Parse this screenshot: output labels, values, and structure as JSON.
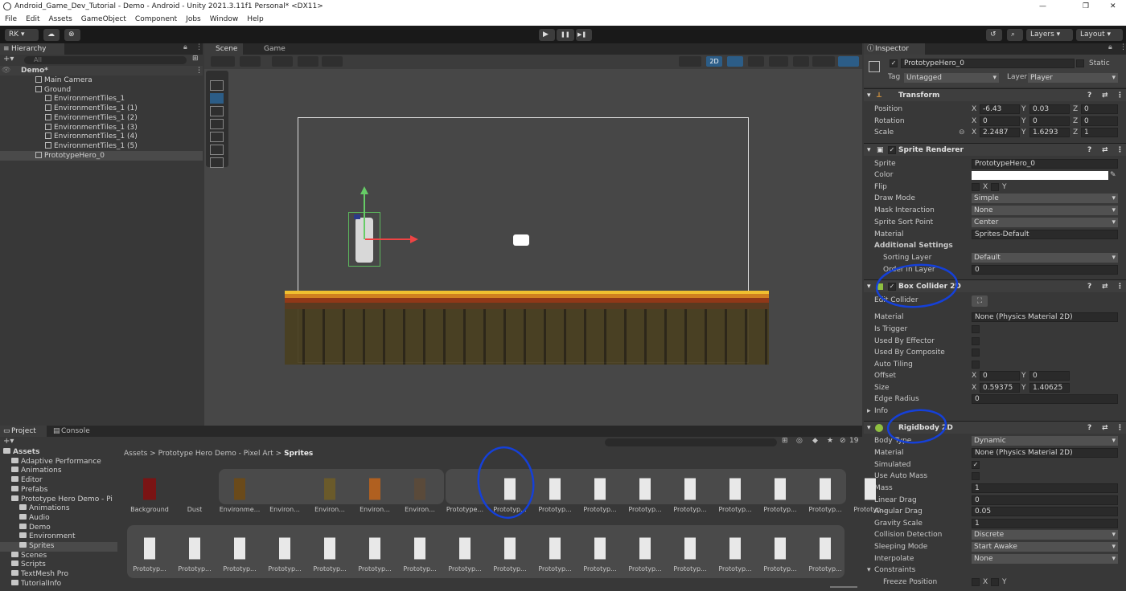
{
  "window": {
    "title": "Android_Game_Dev_Tutorial - Demo - Android - Unity 2021.3.11f1 Personal* <DX11>",
    "min": "—",
    "max": "❐",
    "close": "✕"
  },
  "menu": [
    "File",
    "Edit",
    "Assets",
    "GameObject",
    "Component",
    "Jobs",
    "Window",
    "Help"
  ],
  "toolbar": {
    "account": "RK ▾",
    "cloud": "☁",
    "collab": "⊗",
    "play": "▶",
    "pause": "❚❚",
    "step": "▶❚",
    "history": "↺",
    "search": "⌕",
    "layers": "Layers",
    "layout": "Layout"
  },
  "hierarchy": {
    "tab": "Hierarchy",
    "add": "+▾",
    "search_placeholder": "All",
    "scene": "Demo*",
    "items": [
      {
        "label": "Main Camera",
        "indent": 1
      },
      {
        "label": "Ground",
        "indent": 1
      },
      {
        "label": "EnvironmentTiles_1",
        "indent": 2
      },
      {
        "label": "EnvironmentTiles_1 (1)",
        "indent": 2
      },
      {
        "label": "EnvironmentTiles_1 (2)",
        "indent": 2
      },
      {
        "label": "EnvironmentTiles_1 (3)",
        "indent": 2
      },
      {
        "label": "EnvironmentTiles_1 (4)",
        "indent": 2
      },
      {
        "label": "EnvironmentTiles_1 (5)",
        "indent": 2
      },
      {
        "label": "PrototypeHero_0",
        "indent": 1
      }
    ]
  },
  "scene": {
    "tab_scene": "Scene",
    "tab_game": "Game",
    "btn_2d": "2D"
  },
  "inspector": {
    "tab": "Inspector",
    "object_name": "PrototypeHero_0",
    "static": "Static",
    "tag_label": "Tag",
    "tag": "Untagged",
    "layer_label": "Layer",
    "layer": "Player",
    "transform": {
      "title": "Transform",
      "position_label": "Position",
      "pos_x": "-6.43",
      "pos_y": "0.03",
      "pos_z": "0",
      "rotation_label": "Rotation",
      "rot_x": "0",
      "rot_y": "0",
      "rot_z": "0",
      "scale_label": "Scale",
      "scale_x": "2.2487",
      "scale_y": "1.6293",
      "scale_z": "1"
    },
    "sprite_renderer": {
      "title": "Sprite Renderer",
      "sprite_label": "Sprite",
      "sprite": "PrototypeHero_0",
      "color_label": "Color",
      "flip_label": "Flip",
      "flip_x": "X",
      "flip_y": "Y",
      "draw_mode_label": "Draw Mode",
      "draw_mode": "Simple",
      "mask_label": "Mask Interaction",
      "mask": "None",
      "sort_label": "Sprite Sort Point",
      "sort": "Center",
      "material_label": "Material",
      "material": "Sprites-Default",
      "additional": "Additional Settings",
      "sorting_layer_label": "Sorting Layer",
      "sorting_layer": "Default",
      "order_label": "Order in Layer",
      "order": "0"
    },
    "box_collider": {
      "title": "Box Collider 2D",
      "edit_label": "Edit Collider",
      "material_label": "Material",
      "material": "None (Physics Material 2D)",
      "trigger": "Is Trigger",
      "effector": "Used By Effector",
      "composite": "Used By Composite",
      "tiling": "Auto Tiling",
      "offset_label": "Offset",
      "off_x": "0",
      "off_y": "0",
      "size_label": "Size",
      "size_x": "0.59375",
      "size_y": "1.40625",
      "edge_label": "Edge Radius",
      "edge": "0",
      "info": "Info"
    },
    "rigidbody": {
      "title": "Rigidbody 2D",
      "body_label": "Body Type",
      "body": "Dynamic",
      "material_label": "Material",
      "material": "None (Physics Material 2D)",
      "simulated": "Simulated",
      "auto_mass": "Use Auto Mass",
      "mass_label": "Mass",
      "mass": "1",
      "linear_label": "Linear Drag",
      "linear": "0",
      "angular_label": "Angular Drag",
      "angular": "0.05",
      "gravity_label": "Gravity Scale",
      "gravity": "1",
      "collision_label": "Collision Detection",
      "collision": "Discrete",
      "sleeping_label": "Sleeping Mode",
      "sleeping": "Start Awake",
      "interpolate_label": "Interpolate",
      "interpolate": "None",
      "constraints": "Constraints",
      "freeze_label": "Freeze Position",
      "fx": "X",
      "fy": "Y"
    }
  },
  "project": {
    "tab_project": "Project",
    "tab_console": "Console",
    "add": "+▾",
    "count": "19",
    "breadcrumb": [
      "Assets",
      "Prototype Hero Demo - Pixel Art",
      "Sprites"
    ],
    "tree": [
      {
        "label": "Assets",
        "indent": 0,
        "bold": true
      },
      {
        "label": "Adaptive Performance",
        "indent": 1
      },
      {
        "label": "Animations",
        "indent": 1
      },
      {
        "label": "Editor",
        "indent": 1
      },
      {
        "label": "Prefabs",
        "indent": 1
      },
      {
        "label": "Prototype Hero Demo - Pi",
        "indent": 1
      },
      {
        "label": "Animations",
        "indent": 2
      },
      {
        "label": "Audio",
        "indent": 2
      },
      {
        "label": "Demo",
        "indent": 2
      },
      {
        "label": "Environment",
        "indent": 2
      },
      {
        "label": "Sprites",
        "indent": 2
      },
      {
        "label": "Scenes",
        "indent": 1
      },
      {
        "label": "Scripts",
        "indent": 1
      },
      {
        "label": "TextMesh Pro",
        "indent": 1
      },
      {
        "label": "TutorialInfo",
        "indent": 1
      }
    ],
    "row1": [
      "Background",
      "Dust",
      "Environme...",
      "Environ...",
      "Environ...",
      "Environ...",
      "Environ...",
      "Prototype...",
      "Prototyp...",
      "Prototyp...",
      "Prototyp...",
      "Prototyp...",
      "Prototyp...",
      "Prototyp...",
      "Prototyp...",
      "Prototyp...",
      "Prototyp..."
    ],
    "row2": [
      "Prototyp...",
      "Prototyp...",
      "Prototyp...",
      "Prototyp...",
      "Prototyp...",
      "Prototyp...",
      "Prototyp...",
      "Prototyp...",
      "Prototyp...",
      "Prototyp...",
      "Prototyp...",
      "Prototyp...",
      "Prototyp...",
      "Prototyp...",
      "Prototyp...",
      "Prototyp..."
    ]
  },
  "colors": {
    "accent": "#2c5d87",
    "annotation": "#1540d8",
    "ground_top": "#e0b020"
  }
}
